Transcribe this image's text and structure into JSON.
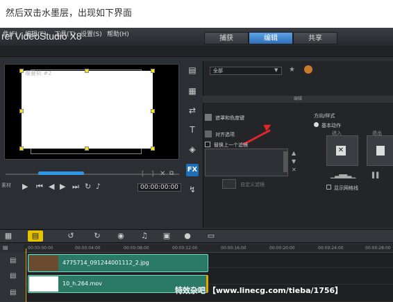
{
  "caption": "然后双击水墨层，出现如下界面",
  "app": {
    "title": "rel VideoStudio X8",
    "tabs": [
      "捕获",
      "编辑",
      "共享"
    ],
    "active_tab": "编辑",
    "menu": [
      "件(F)",
      "编辑(E)",
      "工具(T)",
      "设置(S)",
      "帮助(H)"
    ]
  },
  "preview": {
    "track_label": "覆叠轨 #2",
    "timecode": "00:00:00:00",
    "material_label": "素材"
  },
  "library": {
    "dropdown": "全部",
    "header": "编辑",
    "items": [
      "遮罩和色度键",
      "对齐选项",
      "替换上一个滤镜"
    ],
    "stepper_label": "自定义滤镜",
    "direction_label": "方向/样式",
    "basic_action": "基本动作",
    "enter_label": "进入",
    "exit_label": "退出",
    "show_grid": "显示网格线"
  },
  "timeline": {
    "ticks": [
      "00:00:00:00",
      "00:00:04:00",
      "00:00:08:00",
      "00:00:12:00",
      "00:00:16:00",
      "00:00:20:00",
      "00:00:24:00",
      "00:00:28:00"
    ],
    "clips": [
      {
        "name": "4775714_091244001112_2.jpg"
      },
      {
        "name": "10_h.264.mov"
      }
    ],
    "watermark": "特效杂吧 【www.linecg.com/tieba/1756】"
  },
  "colors": {
    "accent": "#2e95e6",
    "clip": "#2a7a66",
    "arrow": "#e0262a",
    "handle": "#f5e21a"
  }
}
